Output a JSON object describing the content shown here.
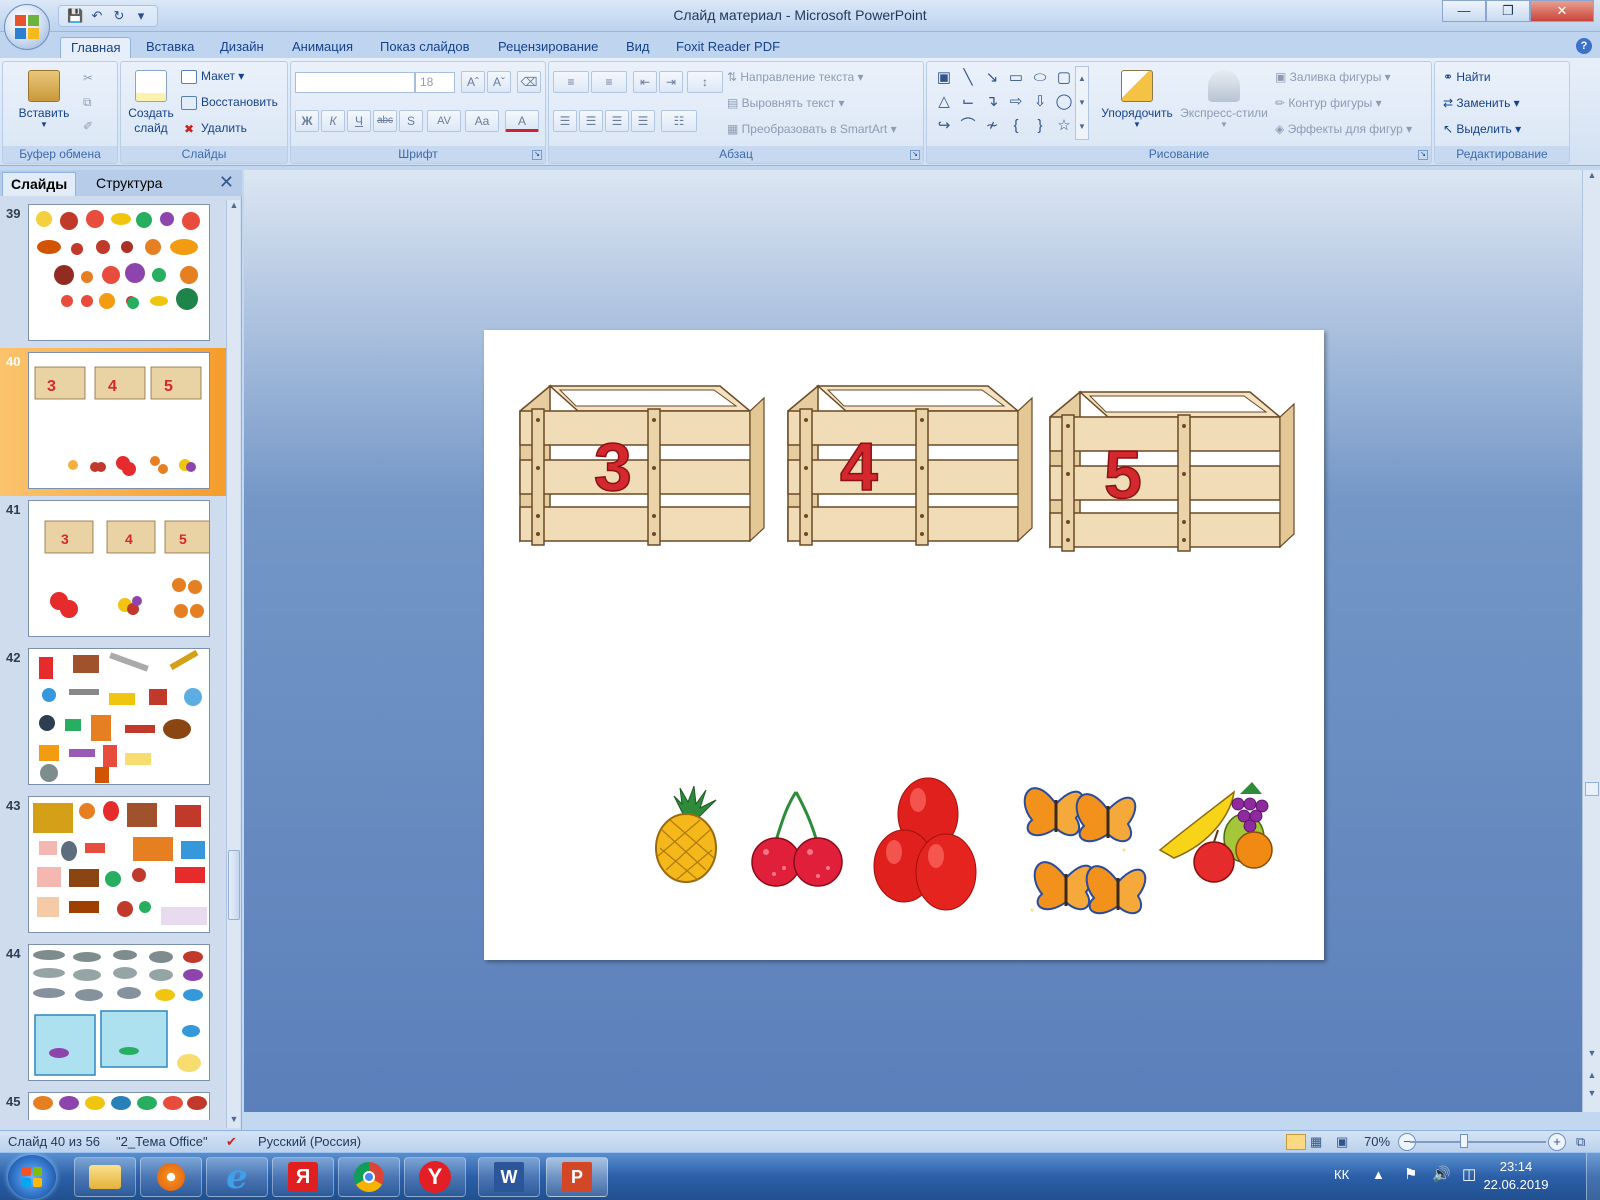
{
  "window": {
    "title": "Слайд материал - Microsoft PowerPoint"
  },
  "tabs": [
    "Главная",
    "Вставка",
    "Дизайн",
    "Анимация",
    "Показ слайдов",
    "Рецензирование",
    "Вид",
    "Foxit Reader PDF"
  ],
  "ribbon": {
    "clipboard": {
      "paste": "Вставить",
      "label": "Буфер обмена"
    },
    "slides": {
      "new_slide": "Создать\nслайд",
      "layout": "Макет",
      "reset": "Восстановить",
      "delete": "Удалить",
      "label": "Слайды"
    },
    "font": {
      "size": "18",
      "label": "Шрифт",
      "bold": "Ж",
      "italic": "К",
      "underline": "Ч",
      "strike": "abc",
      "shadow": "S",
      "spacing": "AV",
      "case": "Aa",
      "color": "A"
    },
    "paragraph": {
      "direction": "Направление текста",
      "align": "Выровнять текст",
      "smartart": "Преобразовать в SmartArt",
      "label": "Абзац"
    },
    "drawing": {
      "arrange": "Упорядочить",
      "quick_styles": "Экспресс-стили",
      "fill": "Заливка фигуры",
      "outline": "Контур фигуры",
      "effects": "Эффекты для фигур",
      "label": "Рисование"
    },
    "editing": {
      "find": "Найти",
      "replace": "Заменить",
      "select": "Выделить",
      "label": "Редактирование"
    }
  },
  "pane": {
    "tab_slides": "Слайды",
    "tab_outline": "Структура",
    "thumbnails": [
      {
        "num": "39"
      },
      {
        "num": "40"
      },
      {
        "num": "41"
      },
      {
        "num": "42"
      },
      {
        "num": "43"
      },
      {
        "num": "44"
      },
      {
        "num": "45"
      }
    ]
  },
  "slide": {
    "crates": [
      "3",
      "4",
      "5"
    ]
  },
  "status": {
    "slide_info": "Слайд 40 из 56",
    "theme": "\"2_Тема Office\"",
    "language": "Русский (Россия)",
    "zoom": "70%"
  },
  "taskbar": {
    "lang": "КК",
    "time": "23:14",
    "date": "22.06.2019"
  },
  "colors": {
    "ribbon_bg": "#dae6f5",
    "accent_selected": "#f59d2d",
    "crate_wood": "#f0ddb8",
    "crate_number": "#d3282e"
  }
}
